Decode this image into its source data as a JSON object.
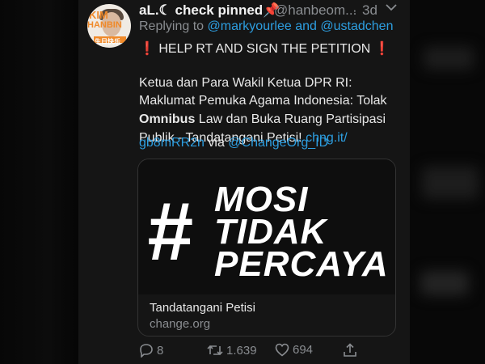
{
  "tweet": {
    "display_name": "aL.☾ check pinned📌",
    "handle": "@hanbeom...",
    "dot": "·",
    "time": "3d",
    "reply_prefix": "Replying to",
    "reply_user1": "@markyourlee",
    "reply_and": "and",
    "reply_user2": "@ustadchen",
    "line1": "❗ HELP RT AND SIGN THE PETITION ❗",
    "line2": "Ketua dan Para Wakil Ketua DPR RI:",
    "line3": "Maklumat Pemuka Agama Indonesia: Tolak",
    "line4_bold": "Omnibus",
    "line4_rest": " Law dan Buka Ruang Partisipasi",
    "line5_text": "Publik - Tandatangani Petisi! ",
    "line5_link": "chng.it/",
    "line6_link": "gb8mRR2n",
    "line6_via": " via ",
    "line6_handle": "@ChangeOrg_ID"
  },
  "avatar": {
    "text1": "KIM",
    "text2": "HANBIN",
    "text3": "生日快乐"
  },
  "card": {
    "hash": "#",
    "word1": "MOSI",
    "word2": "TIDAK",
    "word3": "PERCAYA",
    "title": "Tandatangani Petisi",
    "domain": "change.org"
  },
  "actions": {
    "replies": "8",
    "retweets": "1.639",
    "likes": "694"
  },
  "colors": {
    "link": "#2d9ee0",
    "muted": "#8a8d91",
    "avatar_orange": "#f08a2a"
  }
}
